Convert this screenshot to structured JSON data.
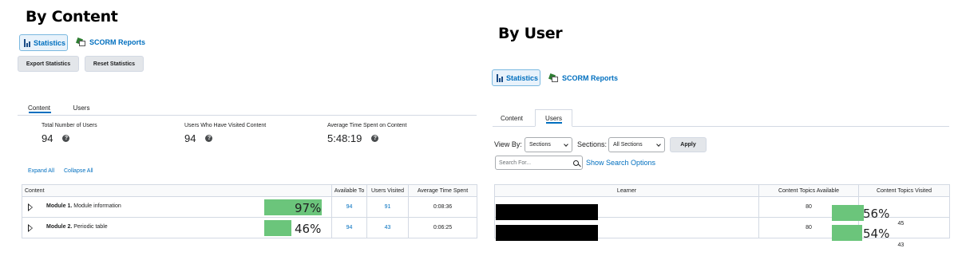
{
  "left": {
    "heading": "By Content",
    "toolbar": {
      "statistics": "Statistics",
      "scorm_reports": "SCORM Reports"
    },
    "buttons": {
      "export": "Export Statistics",
      "reset": "Reset Statistics"
    },
    "tabs": [
      "Content",
      "Users"
    ],
    "summary": [
      {
        "label": "Total Number of Users",
        "value": "94"
      },
      {
        "label": "Users Who Have Visited Content",
        "value": "94"
      },
      {
        "label": "Average Time Spent on Content",
        "value": "5:48:19"
      }
    ],
    "links": {
      "expand_all": "Expand All",
      "collapse_all": "Collapse All"
    },
    "table": {
      "headers": [
        "Content",
        "Available To",
        "Users Visited",
        "Average Time Spent"
      ],
      "rows": [
        {
          "module": "Module 1.",
          "title": "Module information",
          "percent": "97%",
          "percent_value": 97,
          "available_to": "94",
          "users_visited": "91",
          "avg_time": "0:08:36"
        },
        {
          "module": "Module 2.",
          "title": "Periodic table",
          "percent": "46%",
          "percent_value": 46,
          "available_to": "94",
          "users_visited": "43",
          "avg_time": "0:06:25"
        }
      ]
    }
  },
  "right": {
    "heading": "By User",
    "toolbar": {
      "statistics": "Statistics",
      "scorm_reports": "SCORM Reports"
    },
    "tabs": [
      "Content",
      "Users"
    ],
    "filters": {
      "view_by_label": "View By:",
      "view_by_value": "Sections",
      "sections_label": "Sections:",
      "sections_value": "All Sections",
      "apply": "Apply",
      "search_placeholder": "Search For...",
      "show_search_options": "Show Search Options"
    },
    "table": {
      "headers": [
        "Learner",
        "Content Topics Available",
        "Content Topics Visited"
      ],
      "rows": [
        {
          "available": "80",
          "percent": "56%",
          "percent_value": 56,
          "visited": "45"
        },
        {
          "available": "80",
          "percent": "54%",
          "percent_value": 54,
          "visited": "43"
        }
      ]
    }
  },
  "colors": {
    "accent": "#006fbf",
    "progress": "#6bc57b",
    "redaction": "#000000"
  }
}
